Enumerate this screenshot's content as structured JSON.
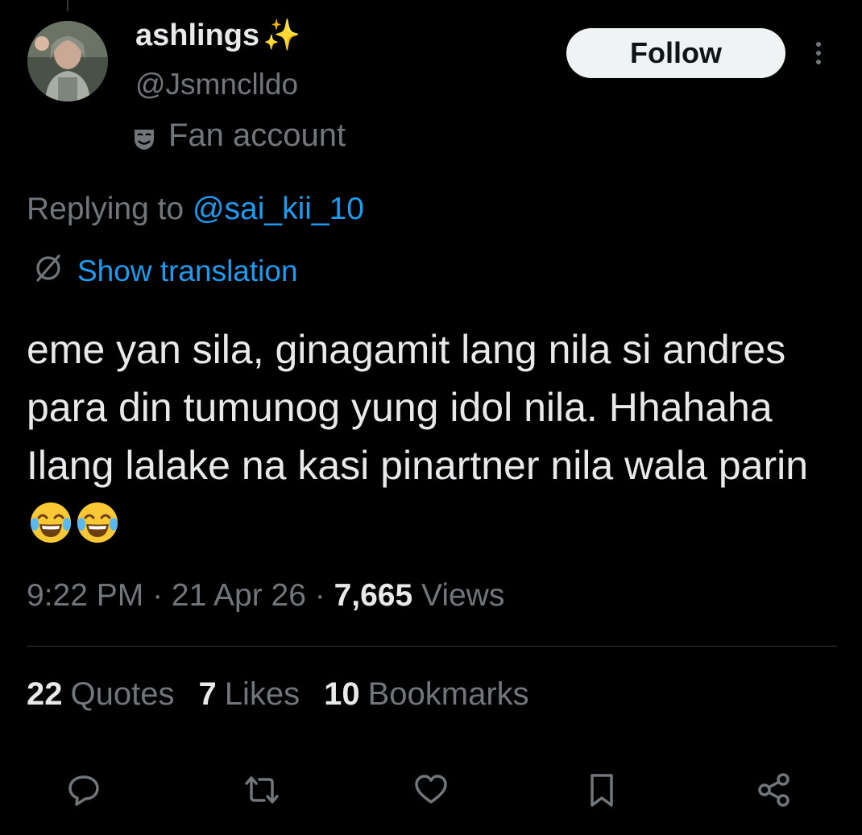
{
  "author": {
    "display_name": "ashlings",
    "name_emoji": "✨",
    "handle": "@Jsmnclldo",
    "label": "Fan account"
  },
  "follow_label": "Follow",
  "reply_context": {
    "prefix": "Replying to ",
    "mention": "@sai_kii_10"
  },
  "translation_label": "Show translation",
  "tweet": {
    "text": "eme yan sila, ginagamit lang nila si andres para din tumunog yung idol nila. Hhahaha Ilang lalake na kasi pinartner nila wala parin",
    "emojis": [
      "face-with-tears-of-joy",
      "face-with-tears-of-joy"
    ]
  },
  "meta": {
    "time": "9:22 PM",
    "separator": " · ",
    "date": "21 Apr 26",
    "views_count": "7,665",
    "views_label": " Views"
  },
  "stats": {
    "quotes_count": "22",
    "quotes_label": "Quotes",
    "likes_count": "7",
    "likes_label": "Likes",
    "bookmarks_count": "10",
    "bookmarks_label": "Bookmarks"
  },
  "actions": [
    "reply-icon",
    "retweet-icon",
    "like-icon",
    "bookmark-icon",
    "share-icon"
  ],
  "colors": {
    "background": "#000000",
    "text_primary": "#e7e9ea",
    "text_secondary": "#71767b",
    "link": "#1d9bf0",
    "divider": "#2f3336"
  }
}
